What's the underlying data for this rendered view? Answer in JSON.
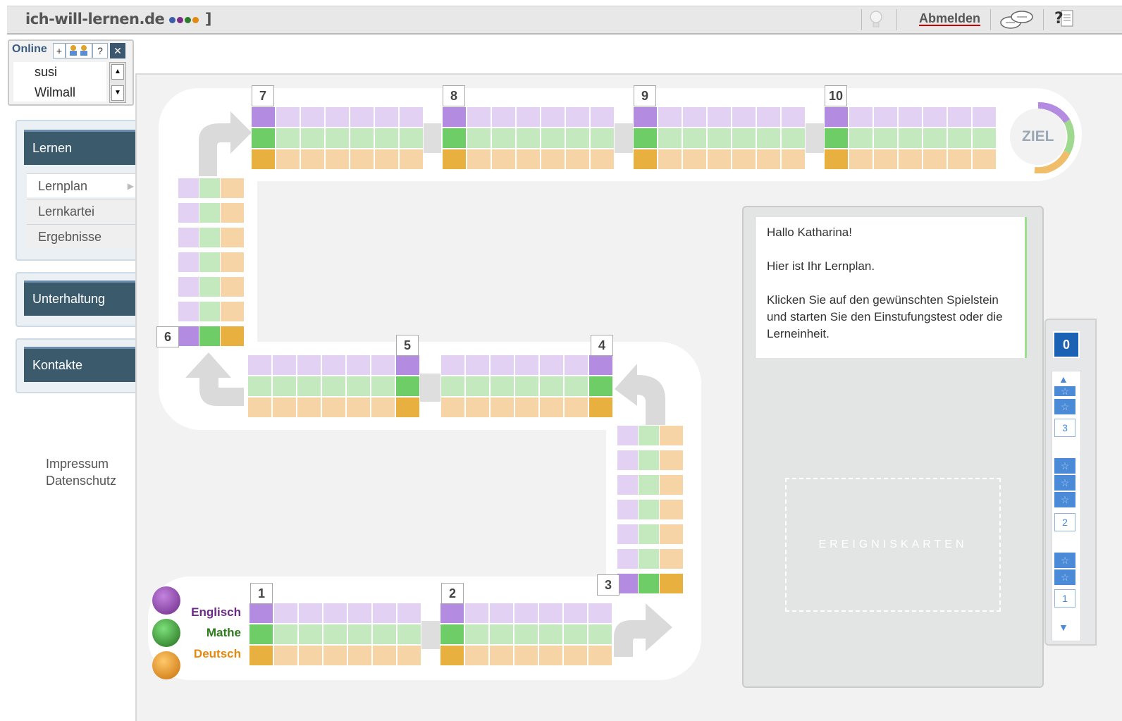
{
  "header": {
    "logo_text": "ich-will-lernen.de",
    "logo_bracket": "]",
    "logout_label": "Abmelden",
    "icons": [
      "lightbulb-icon",
      "chat-icon",
      "help-icon"
    ],
    "logo_dot_colors": [
      "#3a5ea8",
      "#7b2c86",
      "#2c7c2c",
      "#e08a12"
    ]
  },
  "online": {
    "title": "Online",
    "btn_add": "+",
    "btn_help": "?",
    "btn_close": "✕",
    "users": [
      "susi",
      "Wilmall"
    ]
  },
  "sidebar": {
    "sections": [
      {
        "label": "Lernen",
        "items": [
          "Lernplan",
          "Lernkartei",
          "Ergebnisse"
        ]
      },
      {
        "label": "Unterhaltung",
        "items": []
      },
      {
        "label": "Kontakte",
        "items": []
      }
    ],
    "links": [
      "Impressum",
      "Datenschutz"
    ]
  },
  "board": {
    "goal_label": "ZIEL",
    "stations": [
      "1",
      "2",
      "3",
      "4",
      "5",
      "6",
      "7",
      "8",
      "9",
      "10"
    ],
    "subjects": [
      {
        "name": "Englisch",
        "color": "#6a2a86"
      },
      {
        "name": "Mathe",
        "color": "#2e7a1f"
      },
      {
        "name": "Deutsch",
        "color": "#e28a10"
      }
    ],
    "tile_colors": {
      "purple_dark": "#b38be0",
      "purple_light": "#e2d1f2",
      "green_dark": "#6ecd67",
      "green_light": "#c4e9be",
      "orange_dark": "#e8b13f",
      "orange_light": "#f7d4a5"
    }
  },
  "message": {
    "greeting": "Hallo Katharina!",
    "line1": "Hier ist Ihr Lernplan.",
    "line2": "Klicken Sie auf den gewünschten Spielstein und starten Sie den Einstufungstest oder die Lerneinheit.",
    "events_label": "EREIGNISKARTEN"
  },
  "score": {
    "total": "0",
    "levels": [
      "3",
      "2",
      "1"
    ],
    "star_glyph": "☆",
    "up_glyph": "▲",
    "down_glyph": "▼"
  }
}
